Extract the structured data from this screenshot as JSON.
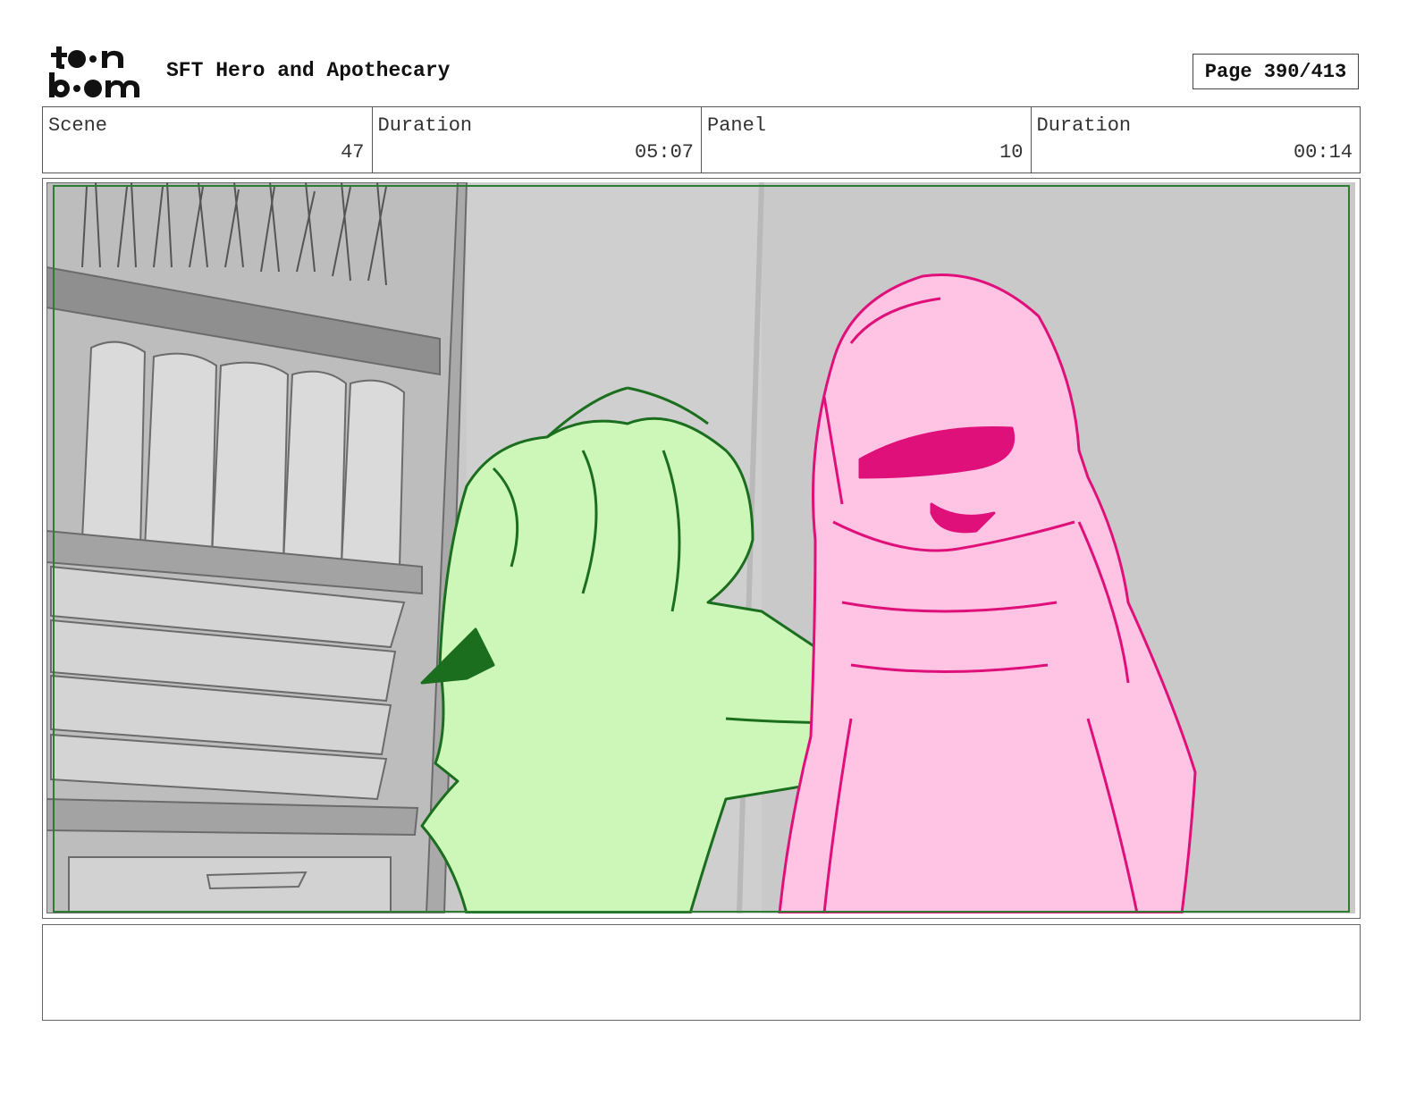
{
  "header": {
    "logo_alt": "toon boom",
    "project_title": "SFT Hero and Apothecary",
    "page_label": "Page 390/413"
  },
  "info": {
    "scene_label": "Scene",
    "scene_value": "47",
    "scene_duration_label": "Duration",
    "scene_duration_value": "05:07",
    "panel_label": "Panel",
    "panel_value": "10",
    "panel_duration_label": "Duration",
    "panel_duration_value": "00:14"
  },
  "notes": {
    "text": ""
  },
  "colors": {
    "safe_frame": "#2e7d32",
    "green_character_fill": "#ccf7b8",
    "green_character_line": "#1b6e1e",
    "pink_character_fill": "#ffc4e4",
    "pink_character_line": "#e0107a",
    "background_gray": "#c9c9c9"
  }
}
